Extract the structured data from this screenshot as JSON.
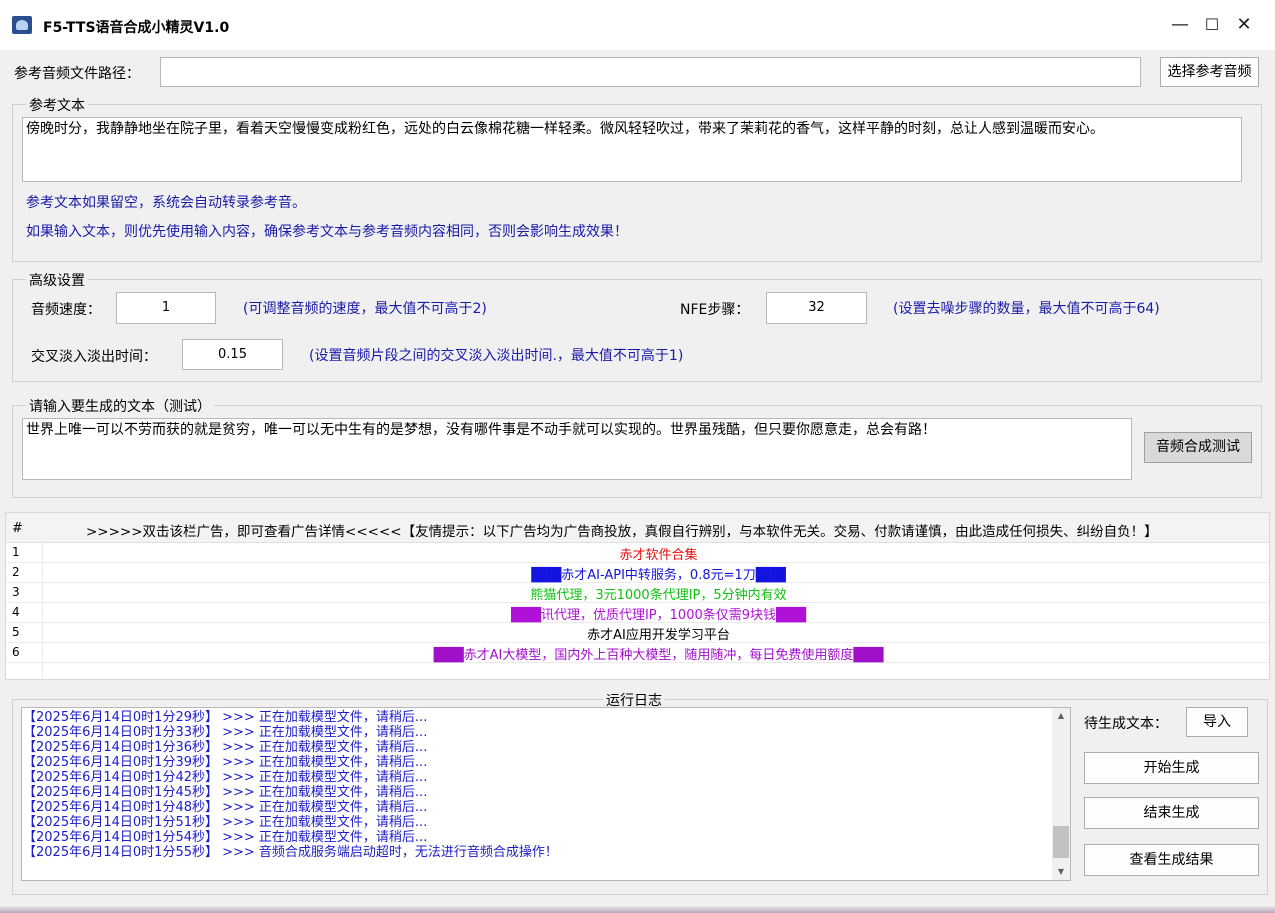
{
  "window": {
    "title": "F5-TTS语音合成小精灵V1.0",
    "minimize": "—",
    "maximize": "☐",
    "close": "✕"
  },
  "ref_audio": {
    "label": "参考音频文件路径：",
    "value": "",
    "button": "选择参考音频"
  },
  "ref_text": {
    "legend": "参考文本",
    "value": "傍晚时分，我静静地坐在院子里，看着天空慢慢变成粉红色，远处的白云像棉花糖一样轻柔。微风轻轻吹过，带来了茉莉花的香气，这样平静的时刻，总让人感到温暖而安心。",
    "hint1": "参考文本如果留空，系统会自动转录参考音。",
    "hint2": "如果输入文本，则优先使用输入内容，确保参考文本与参考音频内容相同，否则会影响生成效果！"
  },
  "advanced": {
    "legend": "高级设置",
    "speed_label": "音频速度：",
    "speed_value": "1",
    "speed_hint": "(可调整音频的速度，最大值不可高于2)",
    "nfe_label": "NFE步骤：",
    "nfe_value": "32",
    "nfe_hint": "(设置去噪步骤的数量，最大值不可高于64)",
    "crossfade_label": "交叉淡入淡出时间：",
    "crossfade_value": "0.15",
    "crossfade_hint": "(设置音频片段之间的交叉淡入淡出时间.，最大值不可高于1)"
  },
  "gen_text": {
    "legend": "请输入要生成的文本（测试）",
    "value": "世界上唯一可以不劳而获的就是贫穷，唯一可以无中生有的是梦想，没有哪件事是不动手就可以实现的。世界虽残酷，但只要你愿意走，总会有路！",
    "button": "音频合成测试"
  },
  "ads": {
    "hash": "#",
    "header": ">>>>>双击该栏广告，即可查看广告详情<<<<<【友情提示：以下广告均为广告商投放，真假自行辨别，与本软件无关。交易、付款请谨慎，由此造成任何损失、纠纷自负！】",
    "rows": [
      {
        "idx": "1",
        "text": "赤才软件合集",
        "color": "#e81010"
      },
      {
        "idx": "2",
        "text": "███赤才AI-API中转服务，0.8元=1刀███",
        "color": "#1414e0"
      },
      {
        "idx": "3",
        "text": "熊猫代理，3元1000条代理IP，5分钟内有效",
        "color": "#10c010"
      },
      {
        "idx": "4",
        "text": "███讯代理，优质代理IP，1000条仅需9块钱███",
        "color": "#b010d8"
      },
      {
        "idx": "5",
        "text": "赤才AI应用开发学习平台",
        "color": "#000000"
      },
      {
        "idx": "6",
        "text": "███赤才AI大模型，国内外上百种大模型，随用随冲，每日免费使用额度███",
        "color": "#a010c8"
      }
    ]
  },
  "log": {
    "legend": "运行日志",
    "lines": [
      "【2025年6月14日0时1分29秒】 >>>  正在加载模型文件，请稍后...",
      "【2025年6月14日0时1分33秒】 >>>  正在加载模型文件，请稍后...",
      "【2025年6月14日0时1分36秒】 >>>  正在加载模型文件，请稍后...",
      "【2025年6月14日0时1分39秒】 >>>  正在加载模型文件，请稍后...",
      "【2025年6月14日0时1分42秒】 >>>  正在加载模型文件，请稍后...",
      "【2025年6月14日0时1分45秒】 >>>  正在加载模型文件，请稍后...",
      "【2025年6月14日0时1分48秒】 >>>  正在加载模型文件，请稍后...",
      "【2025年6月14日0时1分51秒】 >>>  正在加载模型文件，请稍后...",
      "【2025年6月14日0时1分54秒】 >>>  正在加载模型文件，请稍后...",
      "【2025年6月14日0时1分55秒】 >>>  音频合成服务端启动超时，无法进行音频合成操作！"
    ],
    "pending_label": "待生成文本：",
    "import_btn": "导入",
    "start_btn": "开始生成",
    "stop_btn": "结束生成",
    "view_btn": "查看生成结果"
  }
}
